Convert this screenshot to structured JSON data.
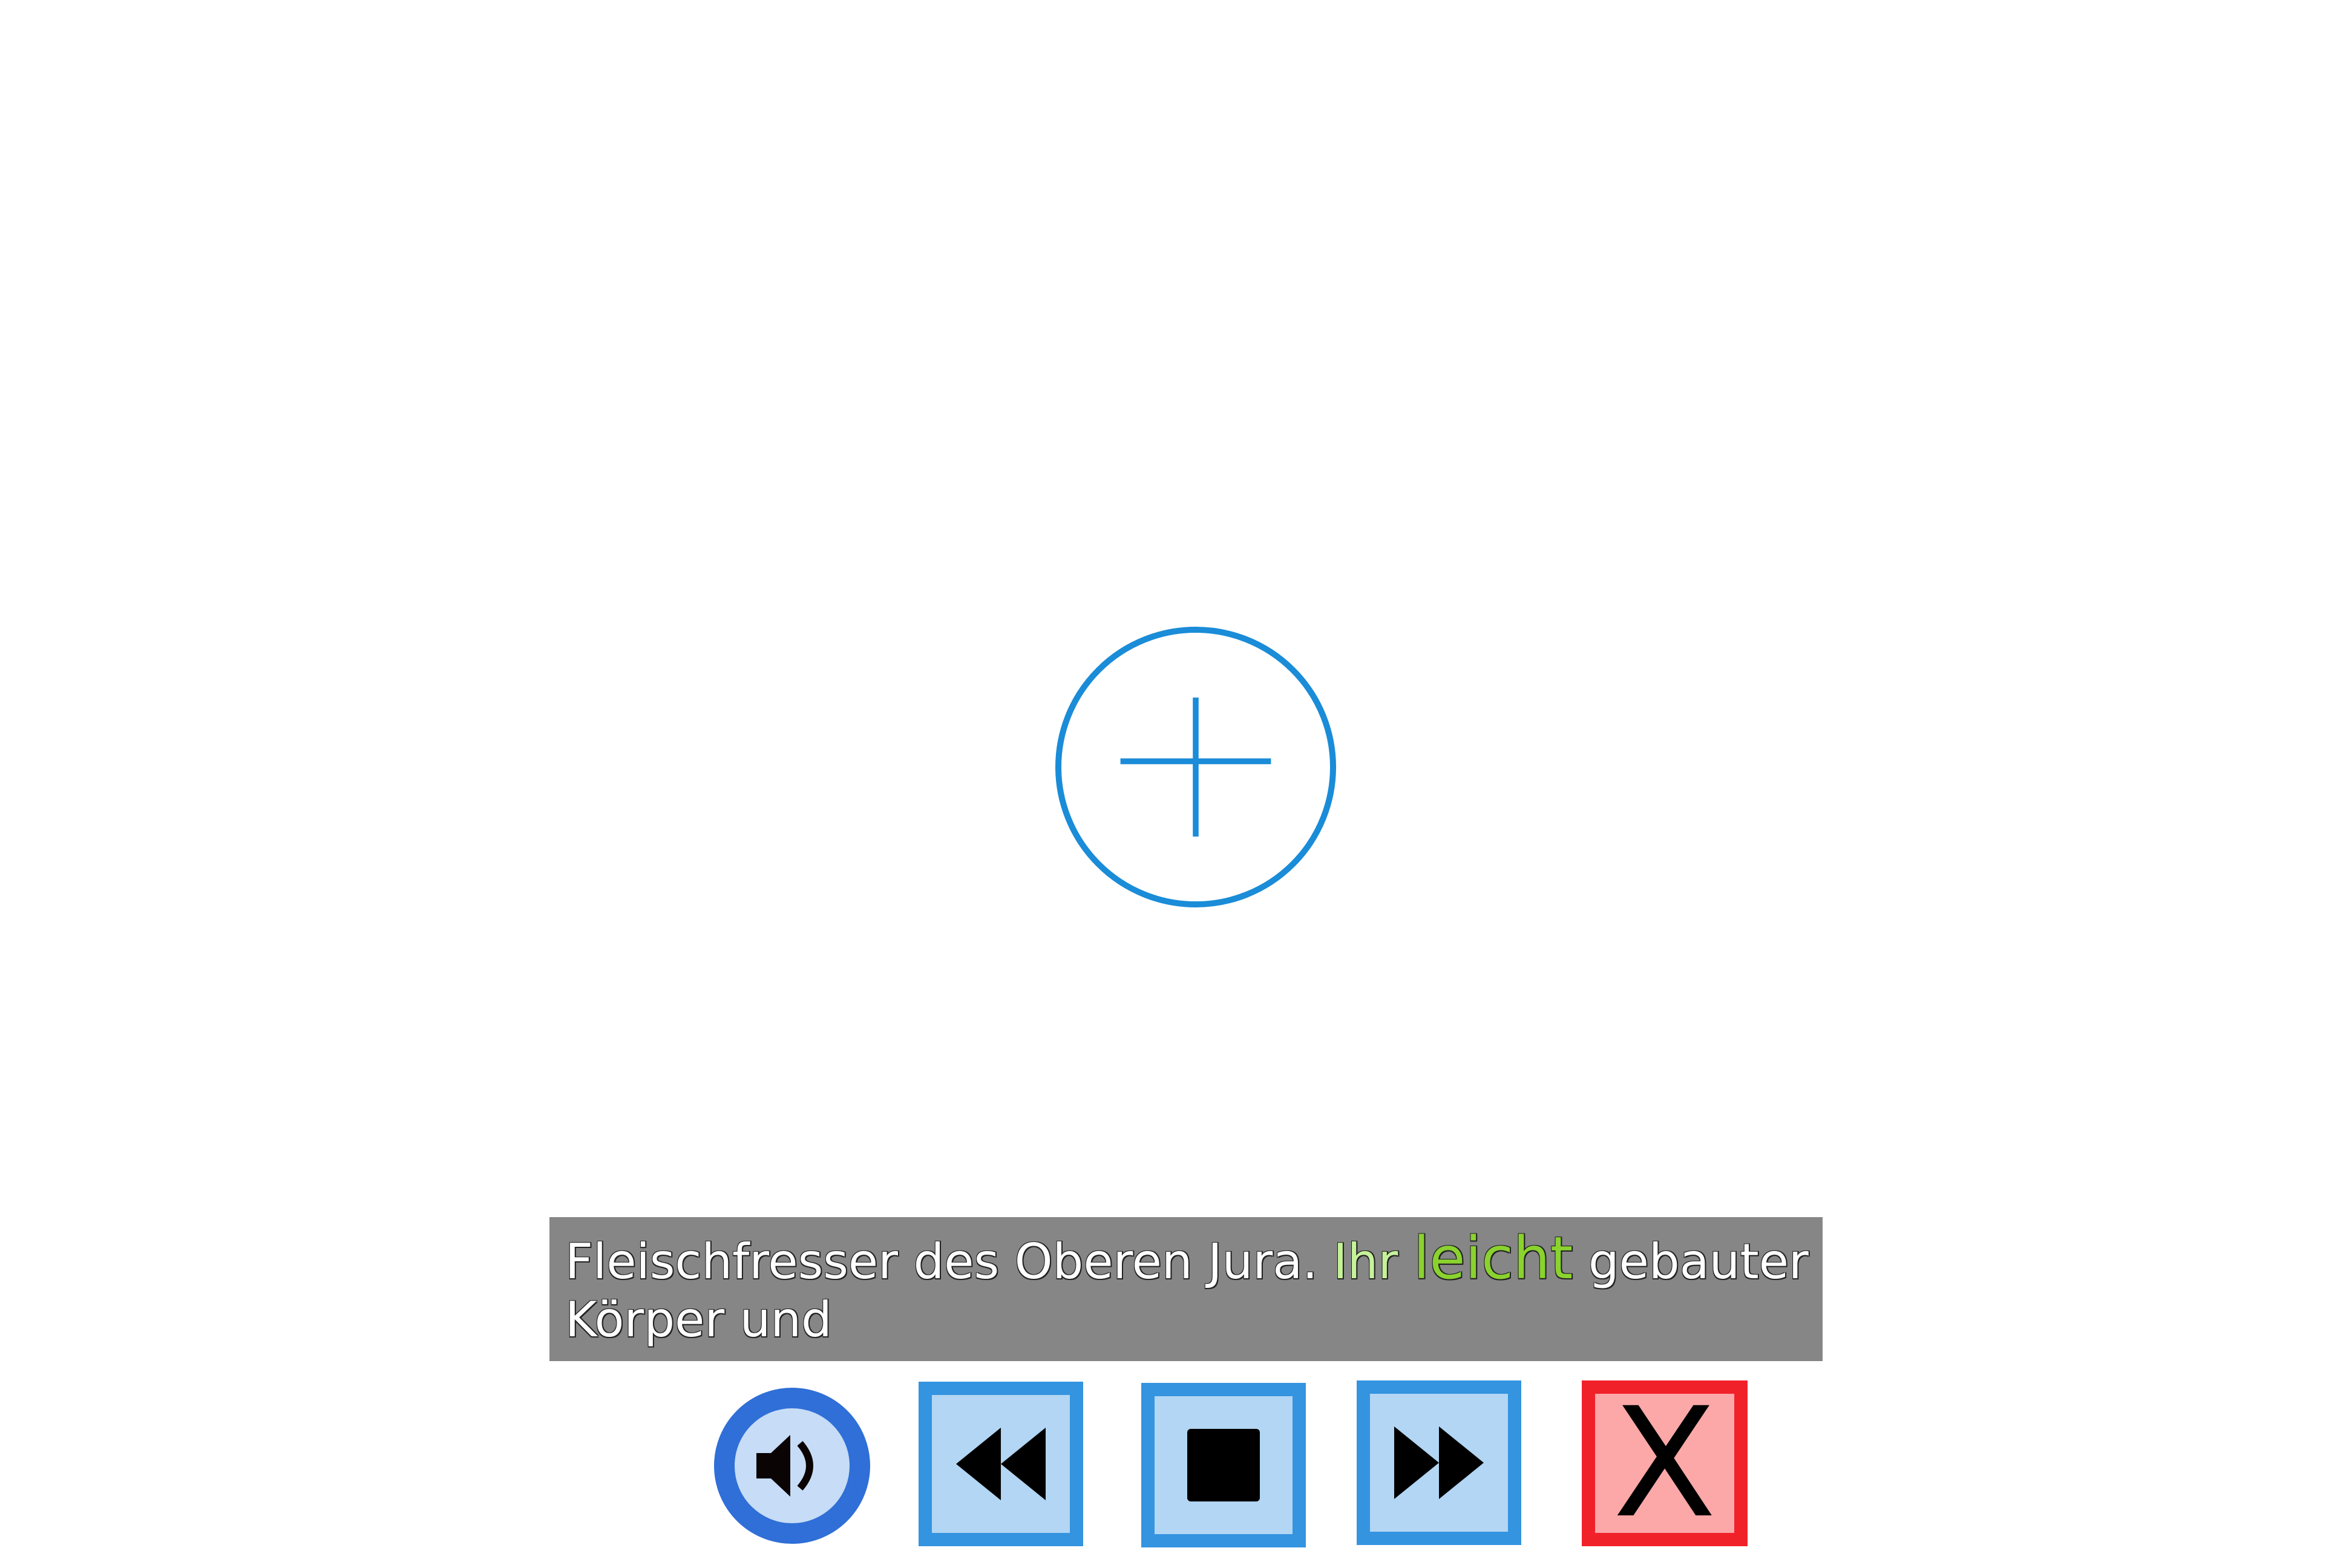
{
  "center": {
    "icon": "plus-circle-icon",
    "color": "#1a8cd8"
  },
  "caption": {
    "text_before": "Fleischfresser des Oberen Jura. ",
    "read_word": "Ihr",
    "current_word": "leicht",
    "text_after": " gebauter",
    "line2": "Körper und",
    "background": "#868686",
    "read_color": "#c6f29a",
    "current_color": "#8ad22e"
  },
  "controls": {
    "speaker": {
      "icon": "speaker-icon"
    },
    "rewind": {
      "icon": "rewind-icon"
    },
    "stop": {
      "icon": "stop-icon"
    },
    "forward": {
      "icon": "fast-forward-icon"
    },
    "close": {
      "icon": "close-icon",
      "label": "X"
    }
  },
  "colors": {
    "control_blue_border": "#3494e0",
    "control_blue_fill": "#b2d6f3",
    "close_border": "#f1212a",
    "close_fill": "#fca8a8"
  }
}
